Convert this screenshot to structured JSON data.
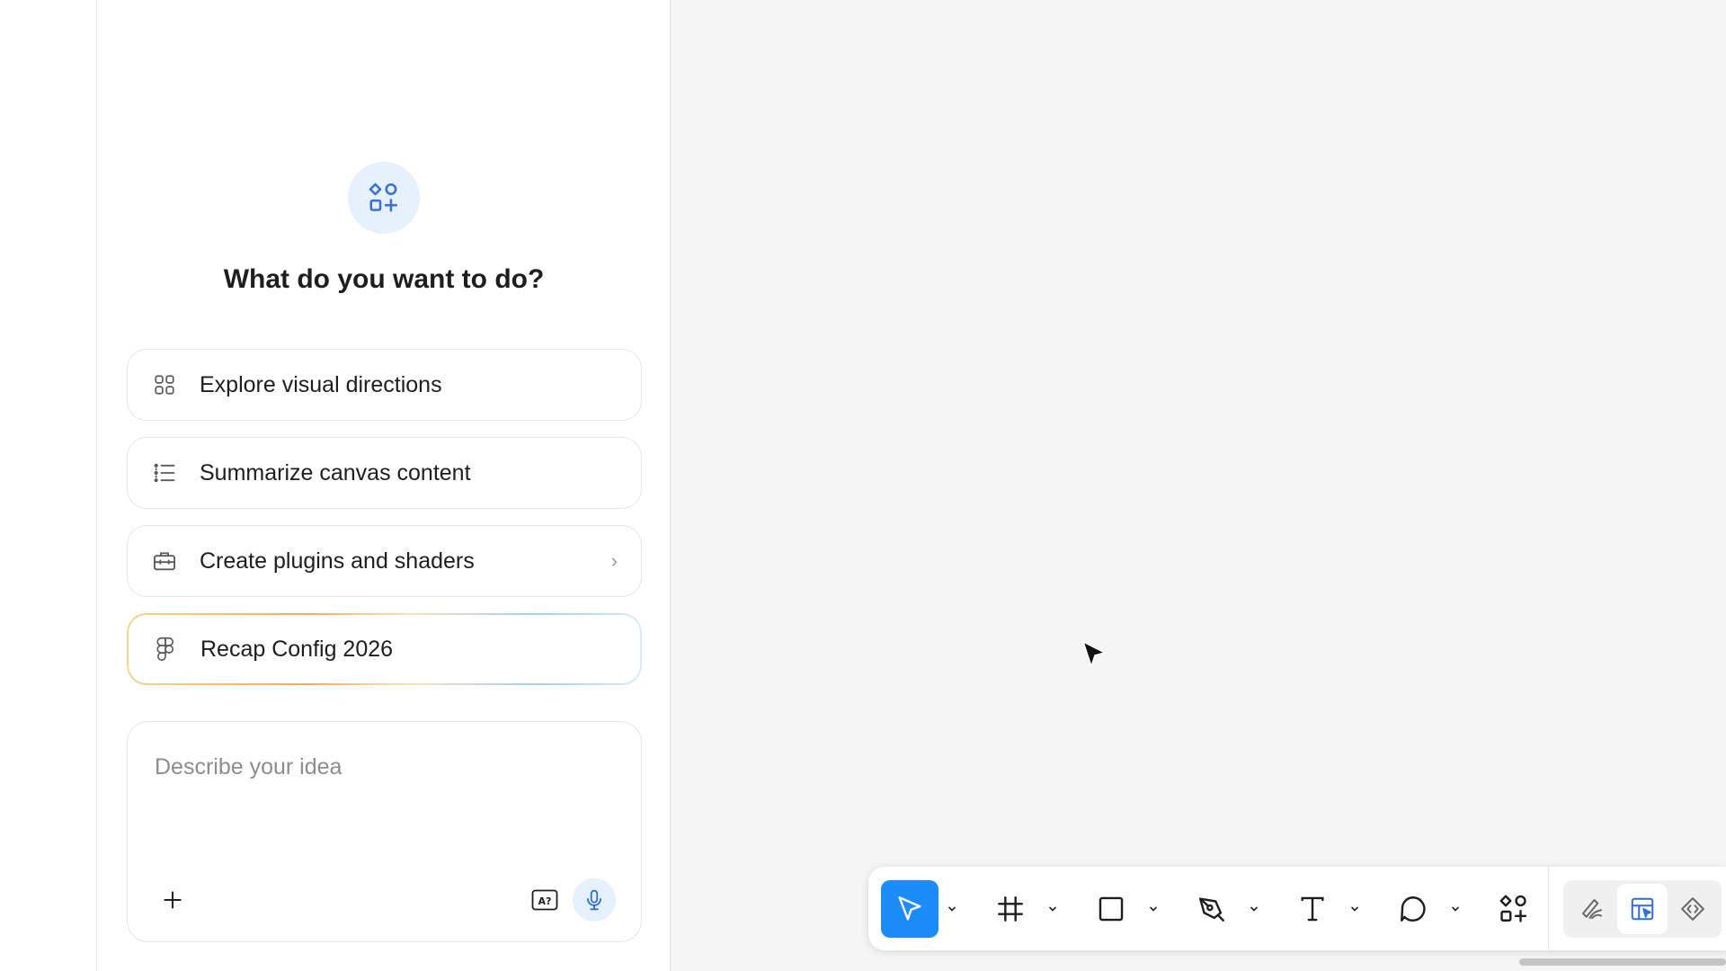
{
  "panel": {
    "title": "What do you want to do?",
    "hero_icon": "shapes-icon",
    "options": [
      {
        "label": "Explore visual directions",
        "icon": "grid-icon"
      },
      {
        "label": "Summarize canvas content",
        "icon": "list-icon"
      },
      {
        "label": "Create plugins and shaders",
        "icon": "toolbox-icon",
        "chevron": "›"
      },
      {
        "label": "Recap Config 2026",
        "icon": "figma-logo-icon"
      }
    ],
    "prompt": {
      "placeholder": "Describe your idea",
      "value": ""
    }
  },
  "toolbar": {
    "tools": [
      {
        "name": "move",
        "icon": "move-arrow-icon",
        "active": true
      },
      {
        "name": "frame",
        "icon": "frame-icon"
      },
      {
        "name": "rectangle",
        "icon": "rectangle-icon"
      },
      {
        "name": "pen",
        "icon": "pen-icon"
      },
      {
        "name": "text",
        "icon": "text-icon"
      },
      {
        "name": "comment",
        "icon": "comment-icon"
      },
      {
        "name": "actions",
        "icon": "shapes-icon"
      }
    ],
    "right_tools": [
      "draw-icon",
      "design-mode-icon",
      "dev-mode-icon"
    ]
  },
  "colors": {
    "accent": "#1c8cf8",
    "accent_light": "#e6f1fd",
    "canvas": "#f5f5f5"
  }
}
